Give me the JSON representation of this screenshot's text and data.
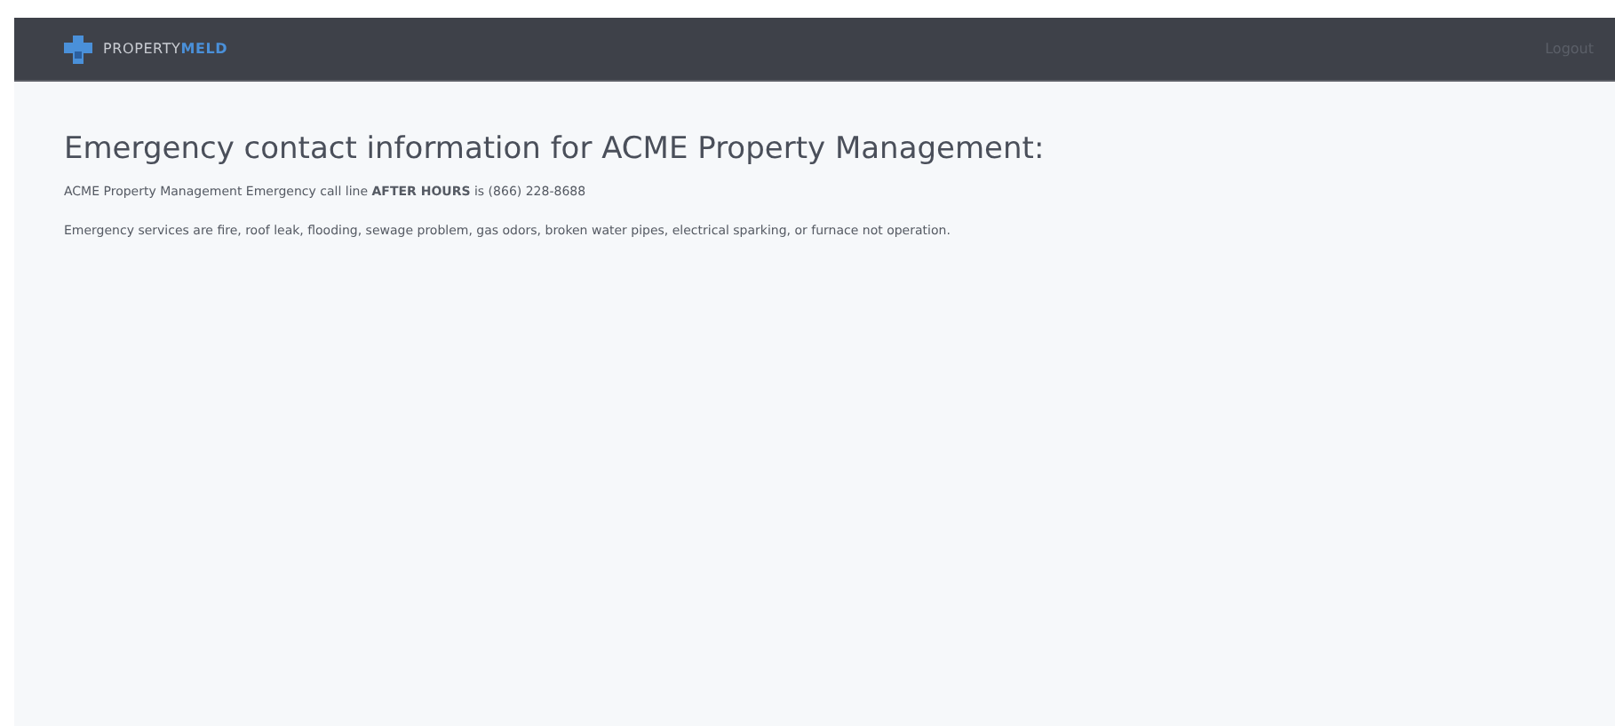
{
  "header": {
    "logo": {
      "first": "PROPERTY",
      "second": "MELD"
    },
    "logout": "Logout"
  },
  "heading": "Emergency contact information for ACME Property Management:",
  "paragraphs": [
    "ACME Property Management Emergency call line **AFTER HOURS** is (866) 228-8688",
    "Emergency services are fire, roof leak, flooding, sewage problem, gas odors, broken water pipes, electrical sparking, or furnace not operation."
  ]
}
